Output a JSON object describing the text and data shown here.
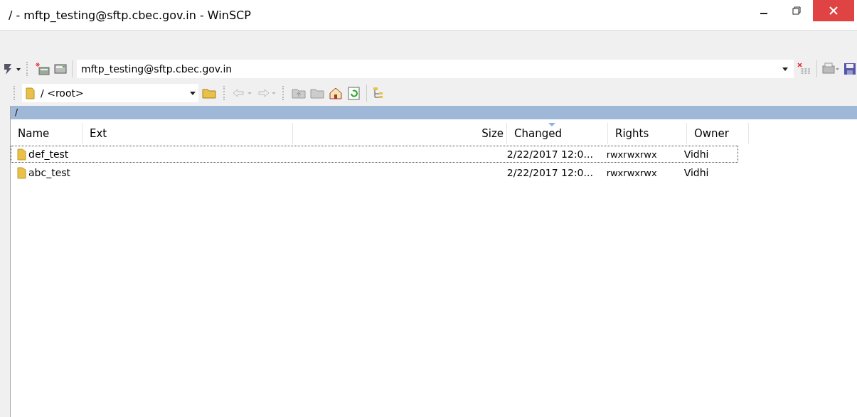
{
  "window": {
    "title": "/ - mftp_testing@sftp.cbec.gov.in - WinSCP"
  },
  "session": {
    "value": "mftp_testing@sftp.cbec.gov.in"
  },
  "location": {
    "value": "/ <root>"
  },
  "path_bar": {
    "text": "/"
  },
  "table": {
    "columns": [
      {
        "label": "Name",
        "kind": "name",
        "sorted": false
      },
      {
        "label": "Ext",
        "kind": "ext",
        "sorted": false
      },
      {
        "label": "Size",
        "kind": "size",
        "sorted": false
      },
      {
        "label": "Changed",
        "kind": "changed",
        "sorted": true
      },
      {
        "label": "Rights",
        "kind": "rights",
        "sorted": false
      },
      {
        "label": "Owner",
        "kind": "owner",
        "sorted": false
      }
    ],
    "rows": [
      {
        "name": "def_test",
        "changed": "2/22/2017 12:0...",
        "rights": "rwxrwxrwx",
        "owner": "Vidhi",
        "selected": true
      },
      {
        "name": "abc_test",
        "changed": "2/22/2017 12:0...",
        "rights": "rwxrwxrwx",
        "owner": "Vidhi",
        "selected": false
      }
    ]
  }
}
